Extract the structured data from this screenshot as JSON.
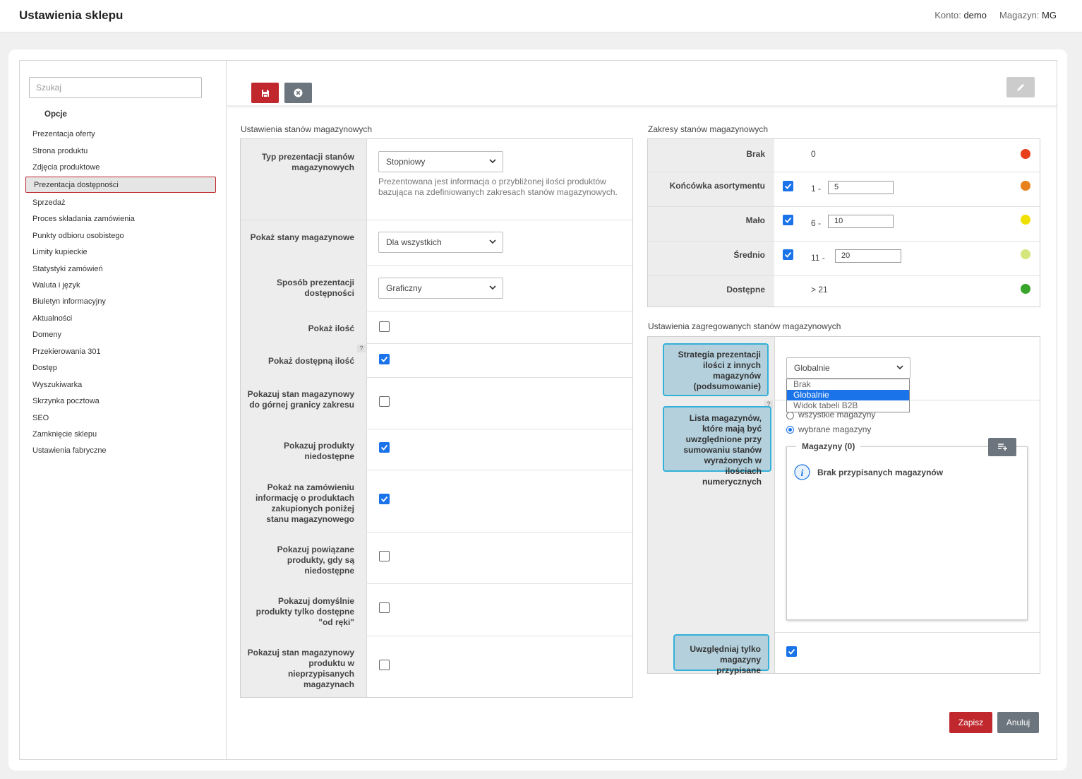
{
  "header": {
    "title": "Ustawienia sklepu",
    "konto_label": "Konto:",
    "konto_value": "demo",
    "magazyn_label": "Magazyn:",
    "magazyn_value": "MG"
  },
  "sidebar": {
    "search_placeholder": "Szukaj",
    "section": "Opcje",
    "items": [
      "Prezentacja oferty",
      "Strona produktu",
      "Zdjęcia produktowe",
      "Prezentacja dostępności",
      "Sprzedaż",
      "Proces składania zamówienia",
      "Punkty odbioru osobistego",
      "Limity kupieckie",
      "Statystyki zamówień",
      "Waluta i język",
      "Biuletyn informacyjny",
      "Aktualności",
      "Domeny",
      "Przekierowania 301",
      "Dostęp",
      "Wyszukiwarka",
      "Skrzynka pocztowa",
      "SEO",
      "Zamknięcie sklepu",
      "Ustawienia fabryczne"
    ],
    "active": "Prezentacja dostępności"
  },
  "toolbar": {
    "save_icon": "floppy-icon",
    "cancel_icon": "x-circle-icon",
    "edit_icon": "pencil-icon"
  },
  "stock_settings": {
    "title": "Ustawienia stanów magazynowych",
    "typ_label": "Typ prezentacji stanów magazynowych",
    "typ_value": "Stopniowy",
    "typ_hint": "Prezentowana jest informacja o przybliżonej ilości produktów bazująca na zdefiniowanych zakresach stanów magazynowych.",
    "pokaz_stany_label": "Pokaż stany magazynowe",
    "pokaz_stany_value": "Dla wszystkich",
    "sposob_label": "Sposób prezentacji dostępności",
    "sposob_value": "Graficzny",
    "checkboxes": [
      {
        "label": "Pokaż ilość",
        "checked": false
      },
      {
        "label": "Pokaż dostępną ilość",
        "checked": true
      },
      {
        "label": "Pokazuj stan magazynowy do górnej granicy zakresu",
        "checked": false
      },
      {
        "label": "Pokazuj produkty niedostępne",
        "checked": true
      },
      {
        "label": "Pokaż na zamówieniu informację o produktach zakupionych poniżej stanu magazynowego",
        "checked": true
      },
      {
        "label": "Pokazuj powiązane produkty, gdy są niedostępne",
        "checked": false
      },
      {
        "label": "Pokazuj domyślnie produkty tylko dostępne \"od ręki\"",
        "checked": false
      },
      {
        "label": "Pokazuj stan magazynowy produktu w nieprzypisanych magazynach",
        "checked": false
      }
    ],
    "help": "?"
  },
  "ranges": {
    "title": "Zakresy stanów magazynowych",
    "rows": [
      {
        "label": "Brak",
        "from": "0",
        "to": "",
        "checked": null,
        "color": "#e8401c"
      },
      {
        "label": "Końcówka asortymentu",
        "from": "1 -",
        "to": "5",
        "checked": true,
        "color": "#e8821c"
      },
      {
        "label": "Mało",
        "from": "6 -",
        "to": "10",
        "checked": true,
        "color": "#f0e000"
      },
      {
        "label": "Średnio",
        "from": "11 -",
        "to": "20",
        "checked": true,
        "color": "#d4e67c"
      },
      {
        "label": "Dostępne",
        "from": "> 21",
        "to": "",
        "checked": null,
        "color": "#3aa52c"
      }
    ]
  },
  "aggregated": {
    "title": "Ustawienia zagregowanych stanów magazynowych",
    "strategy_label": "Strategia prezentacji ilości z innych magazynów (podsumowanie)",
    "strategy_value": "Globalnie",
    "strategy_options": [
      "Brak",
      "Globalnie",
      "Widok tabeli B2B"
    ],
    "list_label": "Lista magazynów, które mają być uwzględnione przy sumowaniu stanów wyrażonych w ilościach numerycznych",
    "radio_all": "wszystkie magazyny",
    "radio_selected": "wybrane magazyny",
    "magazyny_title": "Magazyny (0)",
    "no_warehouses": "Brak przypisanych magazynów",
    "only_assigned_label": "Uwzględniaj tylko magazyny przypisane",
    "only_assigned_checked": true,
    "help": "?"
  },
  "footer": {
    "save": "Zapisz",
    "cancel": "Anuluj"
  }
}
